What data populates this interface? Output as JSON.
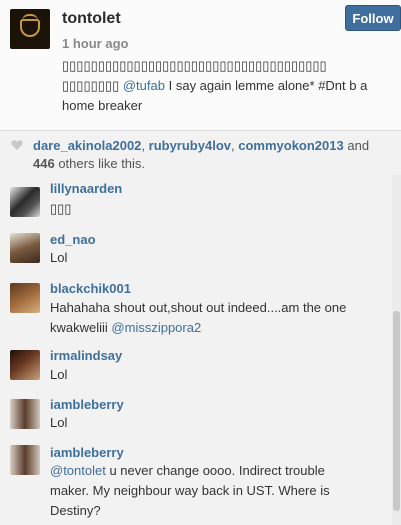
{
  "post": {
    "username": "tontolet",
    "time": "1 hour ago",
    "follow_label": "Follow",
    "caption_line1": "▯▯▯▯▯▯▯▯▯▯▯▯▯▯▯▯▯▯▯▯▯▯▯▯▯▯▯▯▯▯▯▯▯▯▯▯▯",
    "caption_prefix": "▯▯▯▯▯▯▯▯",
    "caption_mention": "@tufab",
    "caption_rest": "I say again lemme alone* #Dnt b a",
    "caption_line3": "home breaker"
  },
  "likes": {
    "user1": "dare_akinola2002",
    "user2": "rubyruby4lov",
    "user3": "commyokon2013",
    "and": "and",
    "count": "446",
    "suffix": "others like this."
  },
  "comments": [
    {
      "user": "lillynaarden",
      "text": "▯▯▯"
    },
    {
      "user": "ed_nao",
      "text": "Lol"
    },
    {
      "user": "blackchik001",
      "text1": "Hahahaha shout out,shout out indeed....am the one",
      "text2": "kwakweliii",
      "mention": "@misszippora2"
    },
    {
      "user": "irmalindsay",
      "text": "Lol"
    },
    {
      "user": "iambleberry",
      "text": "Lol"
    },
    {
      "user": "iambleberry",
      "mention": "@tontolet",
      "text1": "u never change oooo. Indirect trouble",
      "text2": "maker. My neighbour way back in UST. Where is",
      "text3": "Destiny?"
    }
  ],
  "colors": {
    "link": "#3f6f9c",
    "follow_button": "#3f6f9c"
  }
}
